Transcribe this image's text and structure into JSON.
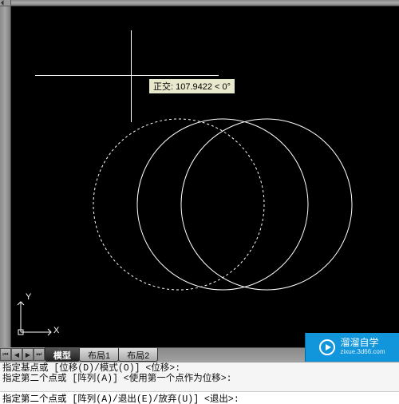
{
  "tooltip": {
    "text": "正交: 107.9422 < 0°"
  },
  "ucs": {
    "x_label": "X",
    "y_label": "Y"
  },
  "tabs": {
    "items": [
      {
        "label": "模型"
      },
      {
        "label": "布局1"
      },
      {
        "label": "布局2"
      }
    ],
    "nav": {
      "first": "◄",
      "prev": "◄",
      "next": "►",
      "last": "►"
    }
  },
  "command": {
    "history": [
      "指定基点或 [位移(D)/模式(O)] <位移>:",
      "指定第二个点或 [阵列(A)] <使用第一个点作为位移>:"
    ],
    "prompt": "指定第二个点或 [阵列(A)/退出(E)/放弃(U)] <退出>:"
  },
  "logo": {
    "brand": "溜溜自学",
    "url": "zixue.3d66.com"
  }
}
